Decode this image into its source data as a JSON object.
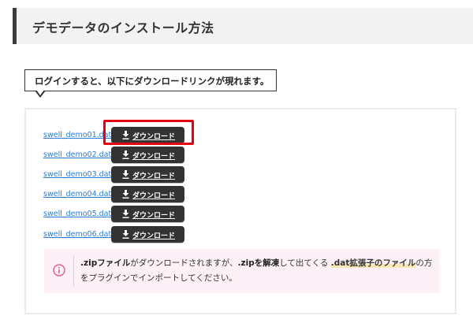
{
  "heading": {
    "title": "デモデータのインストール方法"
  },
  "balloon": {
    "text": "ログインすると、以下にダウンロードリンクが現れます。"
  },
  "downloads": {
    "button_label": "ダウンロード",
    "items": [
      {
        "file": "swell_demo01.dat",
        "highlighted": true
      },
      {
        "file": "swell_demo02.dat",
        "highlighted": false
      },
      {
        "file": "swell_demo03.dat",
        "highlighted": false
      },
      {
        "file": "swell_demo04.dat",
        "highlighted": false
      },
      {
        "file": "swell_demo05.dat",
        "highlighted": false
      },
      {
        "file": "swell_demo06.dat",
        "highlighted": false
      }
    ]
  },
  "info": {
    "part1": ".zipファイル",
    "part2": "がダウンロードされますが、",
    "part3": ".zipを解凍",
    "part4": "して出てくる ",
    "part5": ".dat拡張子のファイル",
    "part6": "の方をプラグインでインポートしてください。"
  },
  "colors": {
    "accent_dark": "#333333",
    "link": "#2a7bd5",
    "highlight_frame": "#e60012",
    "info_background": "#fdf0f6",
    "info_icon": "#e0609a"
  },
  "icons": {
    "download": "download-icon",
    "info": "info-icon"
  }
}
